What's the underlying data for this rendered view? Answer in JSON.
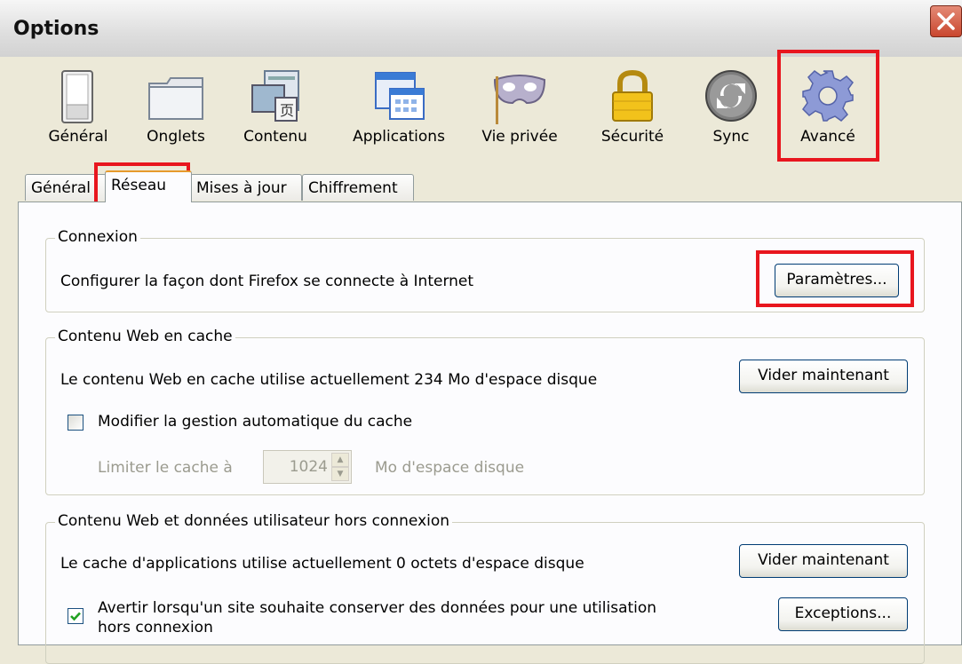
{
  "window": {
    "title": "Options"
  },
  "toolbar": {
    "items": [
      {
        "label": "Général",
        "icon": "general-icon"
      },
      {
        "label": "Onglets",
        "icon": "tabs-folder-icon"
      },
      {
        "label": "Contenu",
        "icon": "content-icon"
      },
      {
        "label": "Applications",
        "icon": "applications-icon"
      },
      {
        "label": "Vie privée",
        "icon": "privacy-mask-icon"
      },
      {
        "label": "Sécurité",
        "icon": "security-lock-icon"
      },
      {
        "label": "Sync",
        "icon": "sync-icon"
      },
      {
        "label": "Avancé",
        "icon": "advanced-gear-icon",
        "selected": true
      }
    ]
  },
  "tabs": [
    {
      "label": "Général"
    },
    {
      "label": "Réseau",
      "active": true
    },
    {
      "label": "Mises à jour"
    },
    {
      "label": "Chiffrement"
    }
  ],
  "connection": {
    "legend": "Connexion",
    "description": "Configurer la façon dont Firefox se connecte à Internet",
    "settings_button": "Paramètres..."
  },
  "cache": {
    "legend": "Contenu Web en cache",
    "description": "Le contenu Web en cache utilise actuellement 234 Mo d'espace disque",
    "clear_button": "Vider maintenant",
    "override_checkbox_label": "Modifier la gestion automatique du cache",
    "override_checked": false,
    "limit_label": "Limiter le cache à",
    "limit_value": "1024",
    "limit_unit": "Mo d'espace disque"
  },
  "offline": {
    "legend": "Contenu Web et données utilisateur hors connexion",
    "description": "Le cache d'applications utilise actuellement 0 octets d'espace disque",
    "clear_button": "Vider maintenant",
    "warn_checkbox_label_line1": "Avertir lorsqu'un site souhaite conserver des données pour une utilisation",
    "warn_checkbox_label_line2": "hors connexion",
    "warn_checked": true,
    "exceptions_button": "Exceptions..."
  },
  "colors": {
    "highlight": "#e8161e",
    "button_border": "#003c74"
  }
}
